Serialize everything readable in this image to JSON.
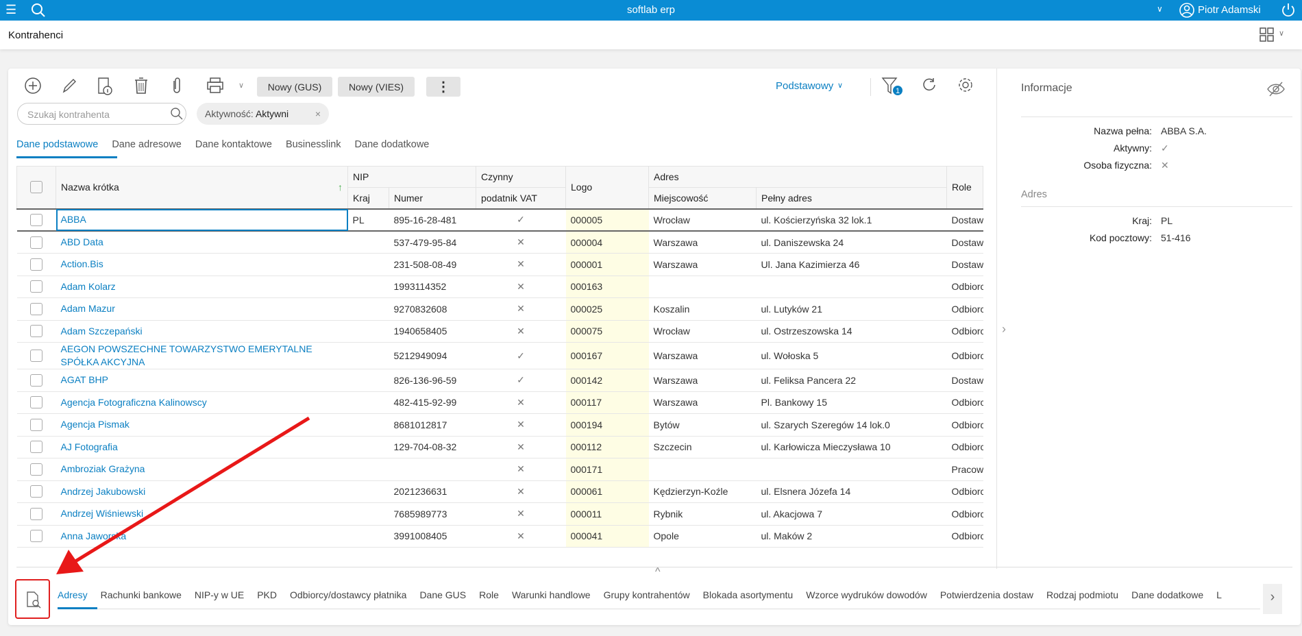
{
  "app": {
    "title": "softlab erp",
    "user": "Piotr Adamski",
    "accent": "#0a8cd4"
  },
  "page": {
    "title": "Kontrahenci"
  },
  "toolbar": {
    "gus": "Nowy (GUS)",
    "vies": "Nowy (VIES)",
    "view": "Podstawowy",
    "filter_count": "1"
  },
  "search": {
    "placeholder": "Szukaj kontrahenta"
  },
  "filter_chip": {
    "label": "Aktywność:",
    "value": "Aktywni",
    "remove": "×"
  },
  "tabs": [
    "Dane podstawowe",
    "Dane adresowe",
    "Dane kontaktowe",
    "Businesslink",
    "Dane dodatkowe"
  ],
  "table": {
    "headers": {
      "name": "Nazwa krótka",
      "nip": "NIP",
      "kraj": "Kraj",
      "numer": "Numer",
      "vat1": "Czynny",
      "vat2": "podatnik VAT",
      "logo": "Logo",
      "adres": "Adres",
      "miejsc": "Miejscowość",
      "pelny": "Pełny adres",
      "role": "Role",
      "sort": "↑"
    },
    "rows": [
      {
        "name": "ABBA",
        "kraj": "PL",
        "numer": "895-16-28-481",
        "vat": "✓",
        "logo": "000005",
        "miejsc": "Wrocław",
        "adres": "ul. Kościerzyńska 32 lok.1",
        "role": "Dostawca"
      },
      {
        "name": "ABD Data",
        "kraj": "",
        "numer": "537-479-95-84",
        "vat": "✕",
        "logo": "000004",
        "miejsc": "Warszawa",
        "adres": "ul. Daniszewska 24",
        "role": "Dostawca"
      },
      {
        "name": "Action.Bis",
        "kraj": "",
        "numer": "231-508-08-49",
        "vat": "✕",
        "logo": "000001",
        "miejsc": "Warszawa",
        "adres": "Ul. Jana Kazimierza 46",
        "role": "Dostawca"
      },
      {
        "name": "Adam Kolarz",
        "kraj": "",
        "numer": "1993114352",
        "vat": "✕",
        "logo": "000163",
        "miejsc": "",
        "adres": "",
        "role": "Odbiorca"
      },
      {
        "name": "Adam Mazur",
        "kraj": "",
        "numer": "9270832608",
        "vat": "✕",
        "logo": "000025",
        "miejsc": "Koszalin",
        "adres": "ul. Lutyków 21",
        "role": "Odbiorca"
      },
      {
        "name": "Adam Szczepański",
        "kraj": "",
        "numer": "1940658405",
        "vat": "✕",
        "logo": "000075",
        "miejsc": "Wrocław",
        "adres": "ul. Ostrzeszowska 14",
        "role": "Odbiorca"
      },
      {
        "name": "AEGON POWSZECHNE TOWARZYSTWO EMERYTALNE SPÓŁKA AKCYJNA",
        "kraj": "",
        "numer": "5212949094",
        "vat": "✓",
        "logo": "000167",
        "miejsc": "Warszawa",
        "adres": "ul. Wołoska 5",
        "role": "Odbiorca"
      },
      {
        "name": "AGAT BHP",
        "kraj": "",
        "numer": "826-136-96-59",
        "vat": "✓",
        "logo": "000142",
        "miejsc": "Warszawa",
        "adres": "ul. Feliksa Pancera 22",
        "role": "Dostawca"
      },
      {
        "name": "Agencja Fotograficzna Kalinowscy",
        "kraj": "",
        "numer": "482-415-92-99",
        "vat": "✕",
        "logo": "000117",
        "miejsc": "Warszawa",
        "adres": "Pl. Bankowy 15",
        "role": "Odbiorca"
      },
      {
        "name": "Agencja Pismak",
        "kraj": "",
        "numer": "8681012817",
        "vat": "✕",
        "logo": "000194",
        "miejsc": "Bytów",
        "adres": "ul. Szarych Szeregów 14 lok.0",
        "role": "Odbiorca"
      },
      {
        "name": "AJ Fotografia",
        "kraj": "",
        "numer": "129-704-08-32",
        "vat": "✕",
        "logo": "000112",
        "miejsc": "Szczecin",
        "adres": "ul. Karłowicza Mieczysława 10",
        "role": "Odbiorca"
      },
      {
        "name": "Ambroziak Grażyna",
        "kraj": "",
        "numer": "",
        "vat": "✕",
        "logo": "000171",
        "miejsc": "",
        "adres": "",
        "role": "Pracownik"
      },
      {
        "name": "Andrzej Jakubowski",
        "kraj": "",
        "numer": "2021236631",
        "vat": "✕",
        "logo": "000061",
        "miejsc": "Kędzierzyn-Koźle",
        "adres": "ul. Elsnera Józefa 14",
        "role": "Odbiorca"
      },
      {
        "name": "Andrzej Wiśniewski",
        "kraj": "",
        "numer": "7685989773",
        "vat": "✕",
        "logo": "000011",
        "miejsc": "Rybnik",
        "adres": "ul. Akacjowa 7",
        "role": "Odbiorca"
      },
      {
        "name": "Anna Jaworska",
        "kraj": "",
        "numer": "3991008405",
        "vat": "✕",
        "logo": "000041",
        "miejsc": "Opole",
        "adres": "ul. Maków 2",
        "role": "Odbiorca"
      }
    ]
  },
  "info": {
    "title": "Informacje",
    "nazwa_label": "Nazwa pełna:",
    "nazwa": "ABBA S.A.",
    "aktywny_label": "Aktywny:",
    "aktywny": "✓",
    "osoba_label": "Osoba fizyczna:",
    "osoba": "✕",
    "adres_title": "Adres",
    "kraj_label": "Kraj:",
    "kraj": "PL",
    "kod_label": "Kod pocztowy:",
    "kod": "51-416"
  },
  "bottom_tabs": [
    "Adresy",
    "Rachunki bankowe",
    "NIP-y w UE",
    "PKD",
    "Odbiorcy/dostawcy płatnika",
    "Dane GUS",
    "Role",
    "Warunki handlowe",
    "Grupy kontrahentów",
    "Blokada asortymentu",
    "Wzorce wydruków dowodów",
    "Potwierdzenia dostaw",
    "Rodzaj podmiotu",
    "Dane dodatkowe",
    "L"
  ]
}
